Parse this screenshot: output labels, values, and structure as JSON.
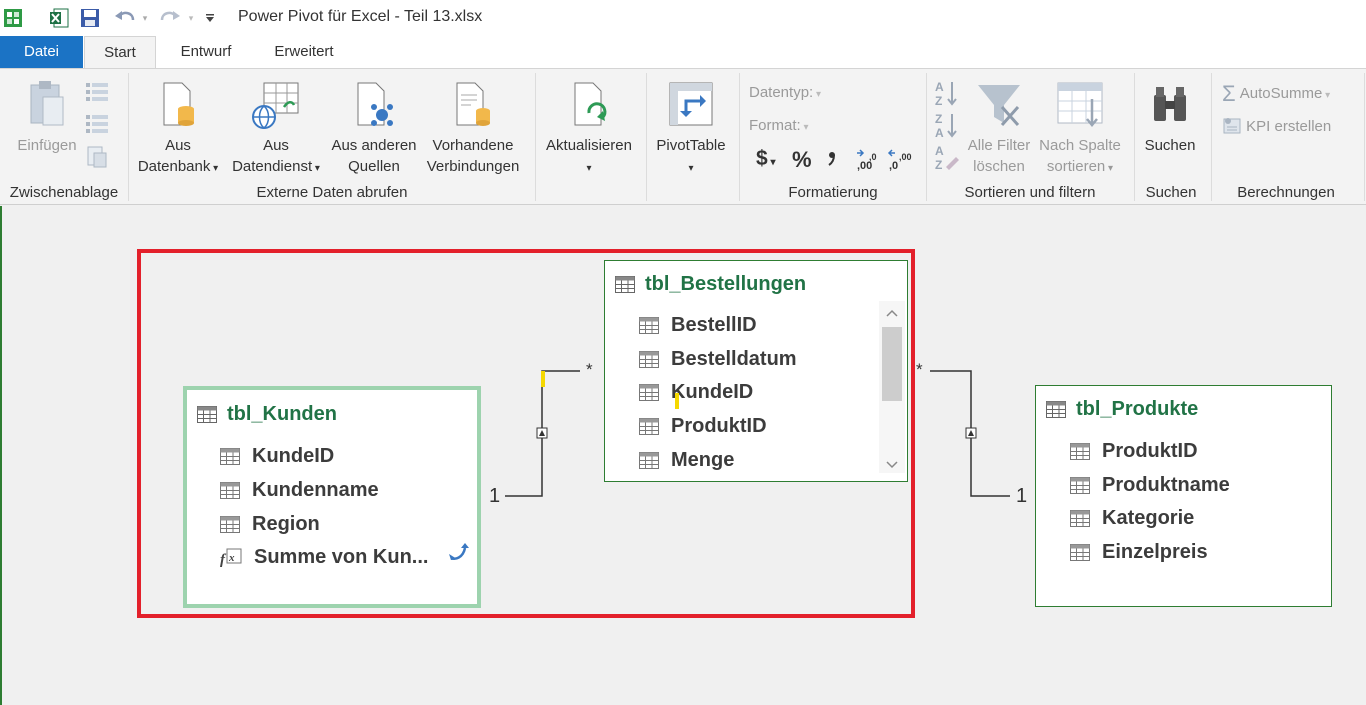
{
  "window": {
    "title": "Power Pivot für Excel - Teil 13.xlsx"
  },
  "tabs": [
    {
      "label": "Datei"
    },
    {
      "label": "Start"
    },
    {
      "label": "Entwurf"
    },
    {
      "label": "Erweitert"
    }
  ],
  "ribbon": {
    "clipboard": {
      "paste": "Einfügen",
      "group": "Zwischenablage"
    },
    "external": {
      "from_db_1": "Aus",
      "from_db_2": "Datenbank",
      "from_service_1": "Aus",
      "from_service_2": "Datendienst",
      "from_other_1": "Aus anderen",
      "from_other_2": "Quellen",
      "existing_1": "Vorhandene",
      "existing_2": "Verbindungen",
      "group": "Externe Daten abrufen"
    },
    "refresh": {
      "label": "Aktualisieren"
    },
    "pivot": {
      "label": "PivotTable"
    },
    "format": {
      "datatype": "Datentyp:",
      "format": "Format:",
      "currency": "$",
      "percent": "%",
      "comma": "̹",
      "group": "Formatierung"
    },
    "sort": {
      "clear_1": "Alle Filter",
      "clear_2": "löschen",
      "bycol_1": "Nach Spalte",
      "bycol_2": "sortieren",
      "group": "Sortieren und filtern"
    },
    "find": {
      "label": "Suchen",
      "group": "Suchen"
    },
    "calc": {
      "autosum": "AutoSumme",
      "kpi": "KPI erstellen",
      "group": "Berechnungen"
    }
  },
  "diagram": {
    "kunden": {
      "name": "tbl_Kunden",
      "columns": [
        {
          "label": "KundeID",
          "icon": "column-icon"
        },
        {
          "label": "Kundenname",
          "icon": "column-icon"
        },
        {
          "label": "Region",
          "icon": "column-icon"
        },
        {
          "label": "Summe von Kun...",
          "icon": "measure-icon"
        }
      ]
    },
    "bestellungen": {
      "name": "tbl_Bestellungen",
      "columns": [
        {
          "label": "BestellID"
        },
        {
          "label": "Bestelldatum"
        },
        {
          "label": "KundeID"
        },
        {
          "label": "ProduktID"
        },
        {
          "label": "Menge"
        }
      ]
    },
    "produkte": {
      "name": "tbl_Produkte",
      "columns": [
        {
          "label": "ProduktID"
        },
        {
          "label": "Produktname"
        },
        {
          "label": "Kategorie"
        },
        {
          "label": "Einzelpreis"
        }
      ]
    },
    "relationships": {
      "one": "1",
      "many": "*"
    }
  },
  "colors": {
    "accent": "#1b73c5",
    "table_header": "#217346",
    "highlight_box": "#e3202b",
    "selected_border": "#9dd3ae"
  }
}
